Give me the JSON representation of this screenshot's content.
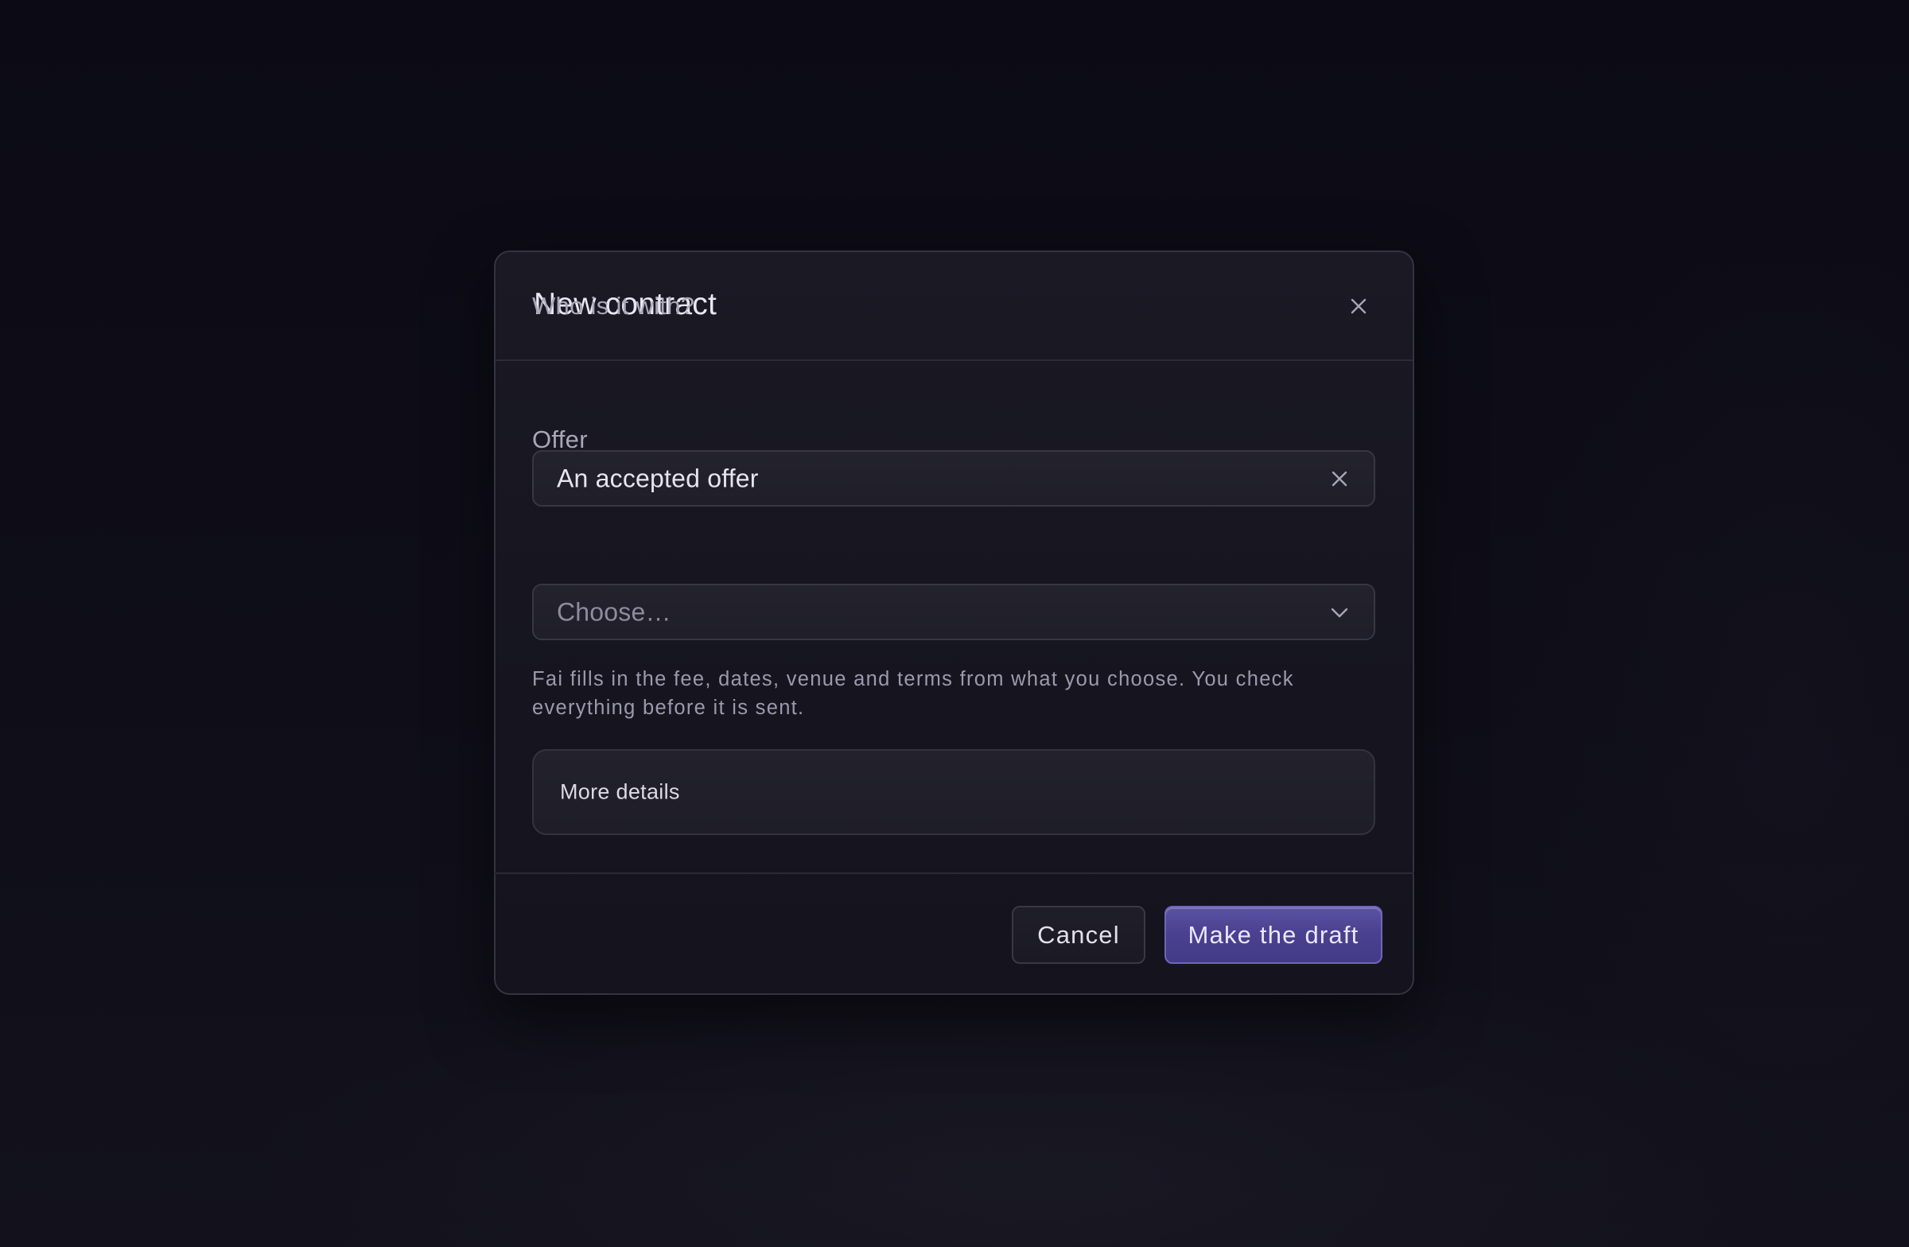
{
  "dialog": {
    "title": "New contract",
    "close_icon": "close-icon"
  },
  "form": {
    "who_label": "Who is it with?",
    "who_value": "An accepted offer",
    "who_clear_icon": "clear-icon",
    "offer_label": "Offer",
    "offer_placeholder": "Choose…",
    "offer_dropdown_icon": "chevron-down-icon",
    "helper_line1": "Fai fills in the fee, dates, venue and terms from what you choose. You check",
    "helper_line2": "everything before it is sent.",
    "more_details_label": "More details"
  },
  "footer": {
    "cancel_label": "Cancel",
    "primary_label": "Make the draft"
  },
  "colors": {
    "background": "#0e0d17",
    "dialog_surface": "#1a1924",
    "primary_accent": "#4a4290",
    "text_primary": "#e6e4ee",
    "text_muted": "#a9a6b8"
  }
}
